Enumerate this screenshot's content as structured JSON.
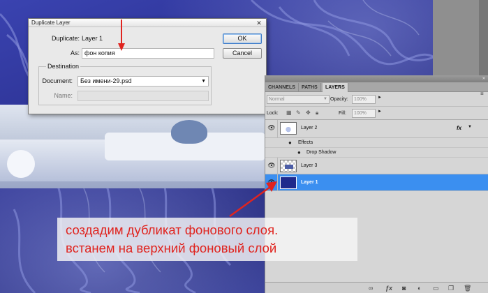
{
  "dialog": {
    "title": "Duplicate Layer",
    "close_glyph": "✕",
    "duplicate_label": "Duplicate:",
    "duplicate_value": "Layer 1",
    "as_label": "As:",
    "as_value": "фон копия",
    "destination_legend": "Destination",
    "document_label": "Document:",
    "document_value": "Без имени-29.psd",
    "name_label": "Name:",
    "ok_label": "OK",
    "cancel_label": "Cancel"
  },
  "layers_panel": {
    "tabs": [
      "CHANNELS",
      "PATHS",
      "LAYERS"
    ],
    "active_tab": "LAYERS",
    "blend_mode": "Normal",
    "opacity_label": "Opacity:",
    "opacity_value": "100%",
    "lock_label": "Lock:",
    "fill_label": "Fill:",
    "fill_value": "100%",
    "layers": [
      {
        "name": "Layer 2",
        "fx": "fx",
        "effects_label": "Effects",
        "effect": "Drop Shadow"
      },
      {
        "name": "Layer 3"
      },
      {
        "name": "Layer 1",
        "selected": true
      }
    ]
  },
  "caption": {
    "line1": "создадим дубликат фонового слоя.",
    "line2": "встанем на верхний фоновый слой",
    "color": "#e0241f"
  },
  "colors": {
    "selection": "#3b8ff0",
    "arrow": "#e0241f"
  }
}
